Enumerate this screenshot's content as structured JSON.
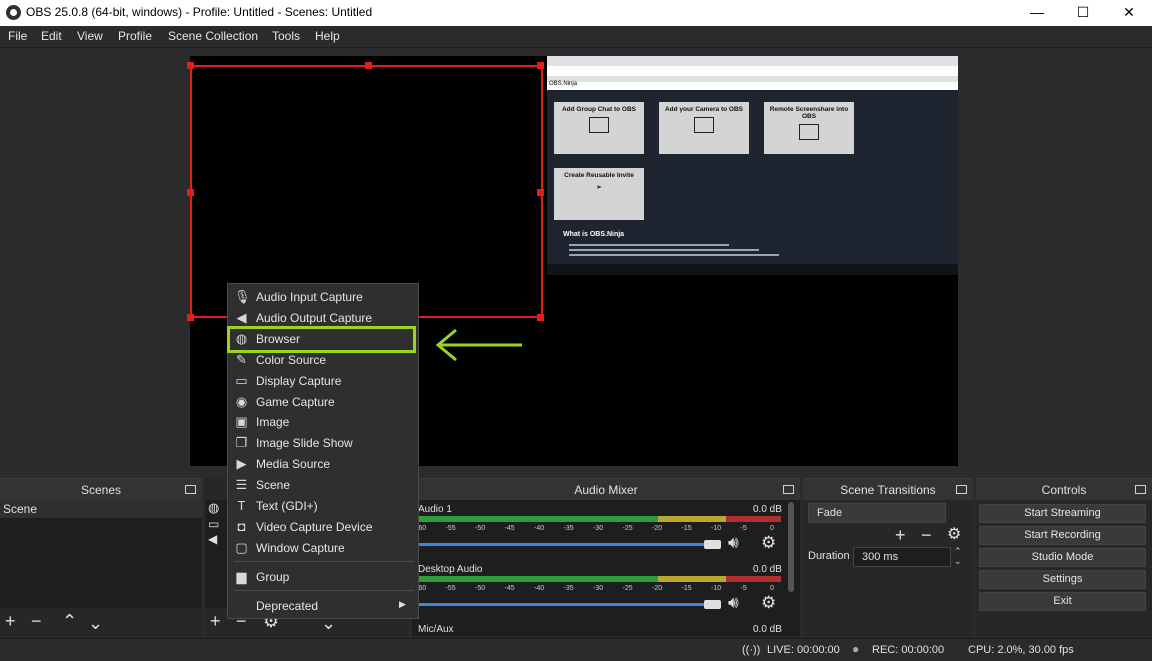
{
  "window": {
    "title": "OBS 25.0.8 (64-bit, windows) - Profile: Untitled - Scenes: Untitled"
  },
  "menubar": [
    "File",
    "Edit",
    "View",
    "Profile",
    "Scene Collection",
    "Tools",
    "Help"
  ],
  "browser_preview": {
    "site": "OBS.Ninja",
    "tiles": [
      "Add Group Chat to OBS",
      "Add your Camera to OBS",
      "Remote Screenshare into OBS",
      "Create Reusable Invite"
    ],
    "heading": "What is OBS.Ninja"
  },
  "add_source_menu": {
    "items": [
      {
        "icon": "microphone-icon",
        "label": "Audio Input Capture"
      },
      {
        "icon": "speaker-icon",
        "label": "Audio Output Capture"
      },
      {
        "icon": "globe-icon",
        "label": "Browser"
      },
      {
        "icon": "paint-brush-icon",
        "label": "Color Source"
      },
      {
        "icon": "monitor-icon",
        "label": "Display Capture"
      },
      {
        "icon": "gamepad-icon",
        "label": "Game Capture"
      },
      {
        "icon": "image-icon",
        "label": "Image"
      },
      {
        "icon": "slideshow-icon",
        "label": "Image Slide Show"
      },
      {
        "icon": "play-icon",
        "label": "Media Source"
      },
      {
        "icon": "list-icon",
        "label": "Scene"
      },
      {
        "icon": "text-icon",
        "label": "Text (GDI+)"
      },
      {
        "icon": "camera-icon",
        "label": "Video Capture Device"
      },
      {
        "icon": "window-icon",
        "label": "Window Capture"
      }
    ],
    "group": "Group",
    "deprecated": "Deprecated",
    "highlight_color": "#9bd41f"
  },
  "scenes": {
    "title": "Scenes",
    "items": [
      "Scene"
    ]
  },
  "audio_mixer": {
    "title": "Audio Mixer",
    "ticks": [
      "-60",
      "-55",
      "-50",
      "-45",
      "-40",
      "-35",
      "-30",
      "-25",
      "-20",
      "-15",
      "-10",
      "-5",
      "0"
    ],
    "channels": [
      {
        "name": "Audio 1",
        "level": "0.0 dB"
      },
      {
        "name": "Desktop Audio",
        "level": "0.0 dB"
      },
      {
        "name": "Mic/Aux",
        "level": "0.0 dB"
      }
    ]
  },
  "scene_transitions": {
    "title": "Scene Transitions",
    "transition": "Fade",
    "duration_label": "Duration",
    "duration_value": "300 ms"
  },
  "controls": {
    "title": "Controls",
    "buttons": [
      "Start Streaming",
      "Start Recording",
      "Studio Mode",
      "Settings",
      "Exit"
    ]
  },
  "status": {
    "live": "LIVE: 00:00:00",
    "rec": "REC: 00:00:00",
    "cpu": "CPU: 2.0%, 30.00 fps"
  },
  "colors": {
    "selection": "#e31c1c",
    "highlight": "#9bd41f",
    "meter_green": "#2f9e3a",
    "meter_yellow": "#b8a830",
    "meter_red": "#b03030",
    "slider": "#3b87e0"
  }
}
